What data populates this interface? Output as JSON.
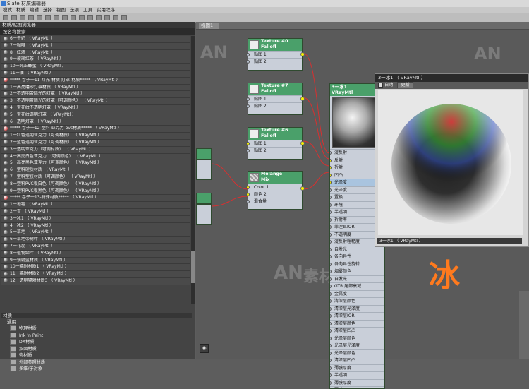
{
  "window": {
    "title": "Slate 材质编辑器"
  },
  "menu": [
    "模式",
    "材质",
    "编辑",
    "选择",
    "视图",
    "选项",
    "工具",
    "实用程序"
  ],
  "left_panel": {
    "title": "材质/贴图浏览器",
    "search": "按名称搜索",
    "materials": [
      {
        "label": "6一牛奶 （ VRayMtl ）",
        "red": false
      },
      {
        "label": "7一咖啡 （ VRayMtl ）",
        "red": false
      },
      {
        "label": "8一红酒 （ VRayMtl ）",
        "red": false
      },
      {
        "label": "9一玻璃红茶 （ VRayMtl ）",
        "red": false
      },
      {
        "label": "10一纯正蜂蜜 （ VRayMtl ）",
        "red": false
      },
      {
        "label": "11一油 （ VRayMtl ）",
        "red": false
      },
      {
        "label": "***** 卷子一11-灯光-材质-灯罩-材质***** （ VRayMtl ）",
        "red": true
      },
      {
        "label": "1一高亮磨砂灯罩材质 （ VRayMtl ）",
        "red": false
      },
      {
        "label": "2一不透明带暗光的灯罩 （ VRayMtl ）",
        "red": false
      },
      {
        "label": "3一不透明带暗光的灯罩（可调颜色） （ VRayMtl ）",
        "red": false
      },
      {
        "label": "4一带花纹不透明灯罩 （ VRayMtl ）",
        "red": false
      },
      {
        "label": "5一带花纹透明灯罩 （ VRayMtl ）",
        "red": false
      },
      {
        "label": "6一透明灯罩 （ VRayMtl ）",
        "red": false
      },
      {
        "label": "***** 卷子一12-塑料 亚克力 pvc材质***** （ VRayMtl ）",
        "red": true
      },
      {
        "label": "1一红色透明亚克力（可调材质） （ VRayMtl ）",
        "red": false
      },
      {
        "label": "2一蓝色透明亚克力（可调材质） （ VRayMtl ）",
        "red": false
      },
      {
        "label": "3一透明亚克力（可调材质） （ VRayMtl ）",
        "red": false
      },
      {
        "label": "4一高亮白色亚克力 （可调颜色） （ VRayMtl ）",
        "red": false
      },
      {
        "label": "5一高亮黑色亚克力（可调颜色） （ VRayMtl ）",
        "red": false
      },
      {
        "label": "6一塑料硬质材质 （ VRayMtl ）",
        "red": false
      },
      {
        "label": "7一塑料塑胶材质（可调颜色） （ VRayMtl ）",
        "red": false
      },
      {
        "label": "8一塑料PVC板白色（可调颜色） （ VRayMtl ）",
        "red": false
      },
      {
        "label": "9一塑料PVC板黑色（可调颜色） （ VRayMtl ）",
        "red": false
      },
      {
        "label": "***** 卷子一13-特殊材质***** （ VRayMtl ）",
        "red": true
      },
      {
        "label": "1一地毯 （ VRayMtl ）",
        "red": false
      },
      {
        "label": "2一雪 （ VRayMtl ）",
        "red": false
      },
      {
        "label": "3一冰1 （ VRayMtl ）",
        "red": false
      },
      {
        "label": "4一冰2 （ VRayMtl ）",
        "red": false
      },
      {
        "label": "5一草地 （ VRayMtl ）",
        "red": false
      },
      {
        "label": "6一草地带树叶 （ VRayMtl ）",
        "red": false
      },
      {
        "label": "7一花蕊 （ VRayMtl ）",
        "red": false
      },
      {
        "label": "8一植物绿叶 （ VRayMtl ）",
        "red": false
      },
      {
        "label": "9一镜射篮材质 （ VRayMtl ）",
        "red": false
      },
      {
        "label": "10一辐射材质1 （ VRayMtl ）",
        "red": false
      },
      {
        "label": "11一辐射材质2 （ VRayMtl ）",
        "red": false
      },
      {
        "label": "12一透明辐射材质3 （ VRayMtl ）",
        "red": false
      }
    ],
    "section": "材质",
    "subsection": "通用",
    "categories": [
      "物理材质",
      "Ink 'n Paint",
      "DX材质",
      "双面材质",
      "壳材质",
      "外部参照材质",
      "多维/子对象"
    ]
  },
  "canvas": {
    "tab": "视图1",
    "watermark": "AN",
    "watermark_cn": "素材库",
    "nodes": [
      {
        "title1": "Texture #0",
        "title2": "Falloff",
        "slots": [
          "贴图 1",
          "贴图 2"
        ]
      },
      {
        "title1": "Texture #7",
        "title2": "Falloff",
        "slots": [
          "贴图 1",
          "贴图 2"
        ]
      },
      {
        "title1": "Texture #6",
        "title2": "Falloff",
        "slots": [
          "贴图 1",
          "贴图 2"
        ]
      },
      {
        "title1": "Melange",
        "title2": "Mix",
        "slots": [
          "Color 1",
          "颜色 2",
          "混合量"
        ]
      }
    ],
    "vray": {
      "title1": "3一冰1",
      "title2": "VRayMtl",
      "slots": [
        "漫反射",
        "反射",
        "折射",
        "凹凸",
        "光泽度",
        "光泽度",
        "置换",
        "环境",
        "半透明",
        "折射率",
        "菲涅耳IOR",
        "不透明度",
        "漫反射粗糙度",
        "自发光",
        "各向异性",
        "各向异性旋转",
        "烟雾颜色",
        "自发光",
        "GTR 尾部衰减",
        "金属度",
        "清漆层颜色",
        "清漆层光泽度",
        "清漆层IOR",
        "清漆层颜色",
        "清漆层凹凸",
        "光泽层颜色",
        "光泽层光泽度",
        "光泽层颜色",
        "清漆层凹凸",
        "薄膜厚度",
        "半透明",
        "薄膜厚度",
        "薄膜IOR"
      ]
    },
    "nav_icon": "binoculars-icon"
  },
  "preview": {
    "title": "3一冰1 （ VRayMtl ）",
    "auto_label": "自动",
    "update_label": "更新",
    "footer": "3一冰1 （ VRayMtl ）"
  },
  "overlay_char": "冰"
}
